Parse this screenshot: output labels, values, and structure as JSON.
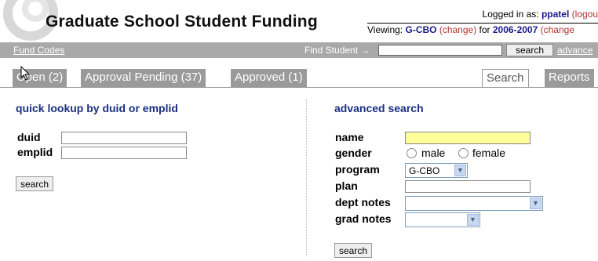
{
  "app": {
    "title": "Graduate School Student Funding"
  },
  "login": {
    "prefix": "Logged in as: ",
    "user": "ppatel",
    "logout": "(logou"
  },
  "viewing": {
    "prefix": "Viewing: ",
    "unit": "G-CBO",
    "unit_change": "(change)",
    "for": " for ",
    "year": "2006-2007",
    "year_change": "(change"
  },
  "bar": {
    "fund_codes": "Fund Codes",
    "find_label": "Find Student →",
    "find_value": "",
    "search_btn": "search",
    "advanced": "advance"
  },
  "tabs": [
    {
      "label": "Open (2)"
    },
    {
      "label": "Approval Pending (37)"
    },
    {
      "label": "Approved (1)"
    },
    {
      "label": "Search"
    },
    {
      "label": "Reports"
    }
  ],
  "quick": {
    "title": "quick lookup by duid or emplid",
    "duid_label": "duid",
    "emplid_label": "emplid",
    "search_btn": "search"
  },
  "advanced": {
    "title": "advanced search",
    "name_label": "name",
    "gender_label": "gender",
    "male": "male",
    "female": "female",
    "program_label": "program",
    "program_value": "G-CBO",
    "plan_label": "plan",
    "dept_label": "dept notes",
    "grad_label": "grad notes",
    "search_btn": "search"
  },
  "colors": {
    "title_blue": "#1a2f80",
    "highlight": "#ffff99",
    "bar_gray": "#a9a9a9"
  }
}
